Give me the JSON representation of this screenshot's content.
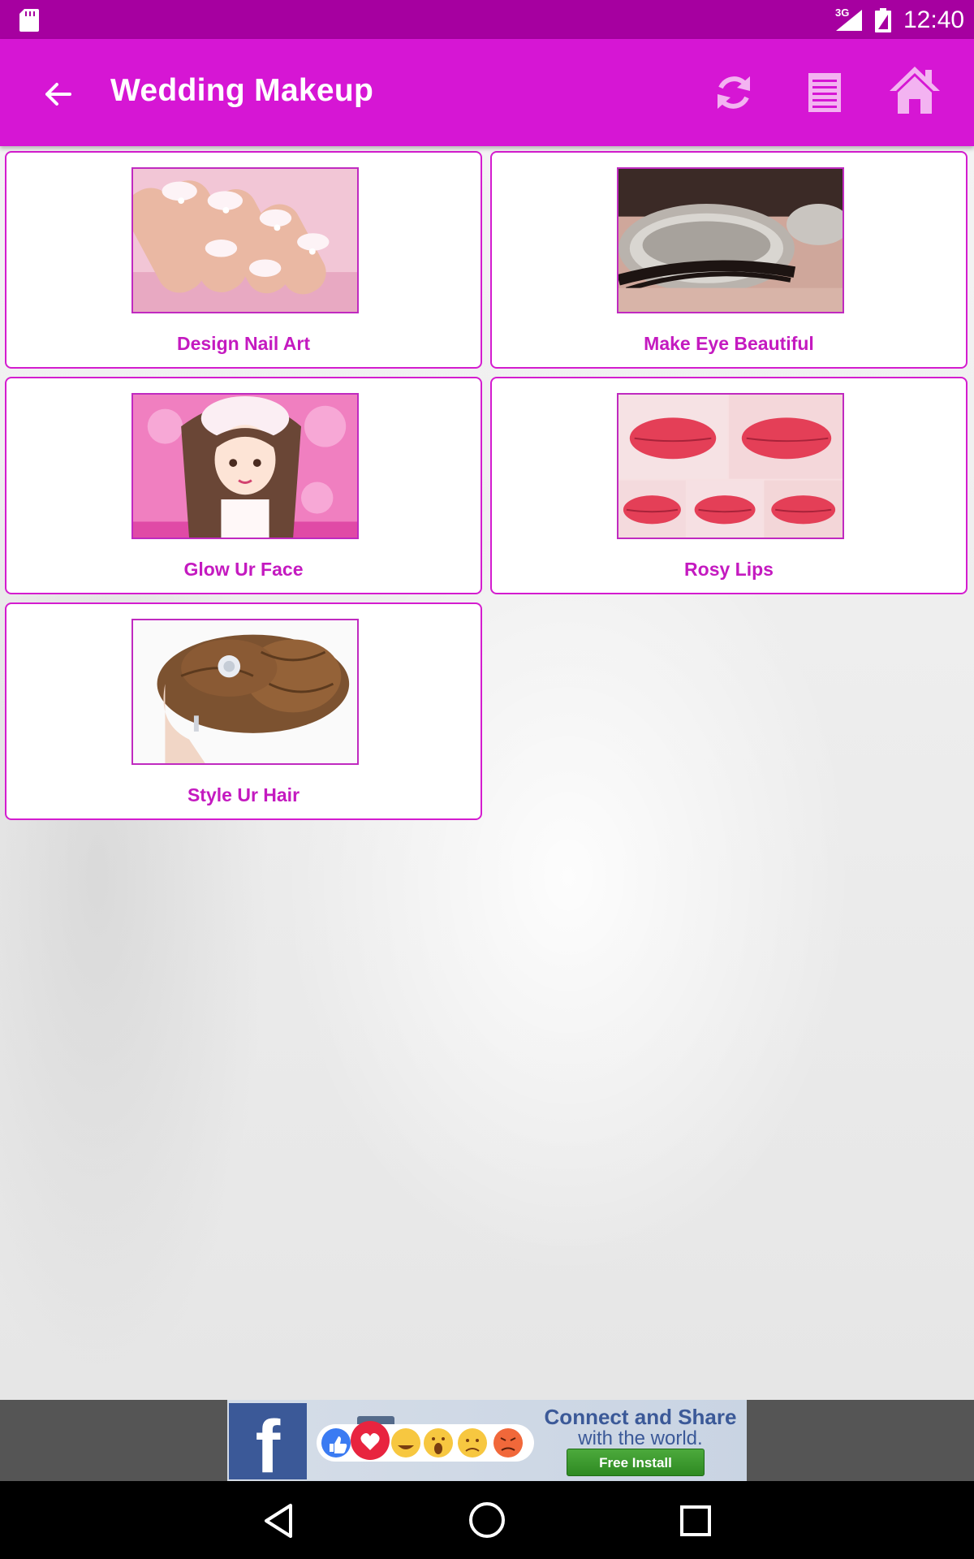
{
  "status_bar": {
    "network": "3G",
    "time": "12:40",
    "icons": [
      "sd-card-icon",
      "signal-icon",
      "battery-icon"
    ]
  },
  "app_bar": {
    "title": "Wedding Makeup",
    "color": "#d616d4",
    "icons": [
      "back-arrow-icon",
      "refresh-icon",
      "list-icon",
      "home-icon"
    ]
  },
  "cards": [
    {
      "label": "Design Nail Art",
      "image": "nail-art-photo"
    },
    {
      "label": "Make Eye Beautiful",
      "image": "glitter-eye-photo"
    },
    {
      "label": "Glow Ur Face",
      "image": "bride-illustration"
    },
    {
      "label": "Rosy Lips",
      "image": "lips-collage-photo"
    },
    {
      "label": "Style Ur Hair",
      "image": "hair-bun-photo"
    }
  ],
  "ad": {
    "headline": "Connect and Share",
    "subline": "with the world.",
    "button_label": "Free Install",
    "logo_letter": "f",
    "brand_color": "#3b5998"
  },
  "nav_bar": {
    "icons": [
      "nav-back-icon",
      "nav-home-icon",
      "nav-recents-icon"
    ]
  },
  "colors": {
    "accent": "#d616d4",
    "status_bar": "#a600a0",
    "card_border": "#d41ccf",
    "card_label": "#c41ac0"
  }
}
